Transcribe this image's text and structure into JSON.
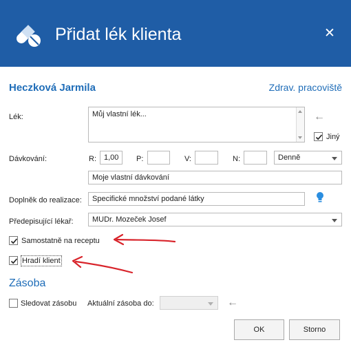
{
  "window": {
    "title": "Přidat lék klienta",
    "close_glyph": "✕",
    "accent_color": "#1f5da6"
  },
  "client": {
    "name": "Heczková Jarmila",
    "workplace_link": "Zdrav. pracoviště"
  },
  "medicine": {
    "label": "Lék:",
    "value": "Můj vlastní lék...",
    "custom_checkbox": {
      "label": "Jiný",
      "checked": true
    }
  },
  "dosage": {
    "label": "Dávkování:",
    "r_label": "R:",
    "r_value": "1,00",
    "p_label": "P:",
    "p_value": "",
    "v_label": "V:",
    "v_value": "",
    "n_label": "N:",
    "n_value": "",
    "frequency": "Denně",
    "custom_text": "Moje vlastní dávkování"
  },
  "supplement": {
    "label": "Doplněk do realizace:",
    "value": "Specifické množství podané látky"
  },
  "doctor": {
    "label": "Předepisující lékař:",
    "value": "MUDr. Mozeček Josef"
  },
  "checkboxes": {
    "separate_prescription": {
      "label": "Samostatně na receptu",
      "checked": true
    },
    "paid_by_client": {
      "label": "Hradí klient",
      "checked": true
    }
  },
  "stock": {
    "section_title": "Zásoba",
    "track_label": "Sledovat zásobu",
    "track_checked": false,
    "current_label": "Aktuální zásoba do:",
    "current_value": ""
  },
  "buttons": {
    "ok": "OK",
    "cancel": "Storno"
  },
  "icons": {
    "app": "pills-icon",
    "back_arrow": "arrow-left-icon",
    "hint": "lightbulb-icon",
    "annotation": "red-arrow-icon"
  }
}
